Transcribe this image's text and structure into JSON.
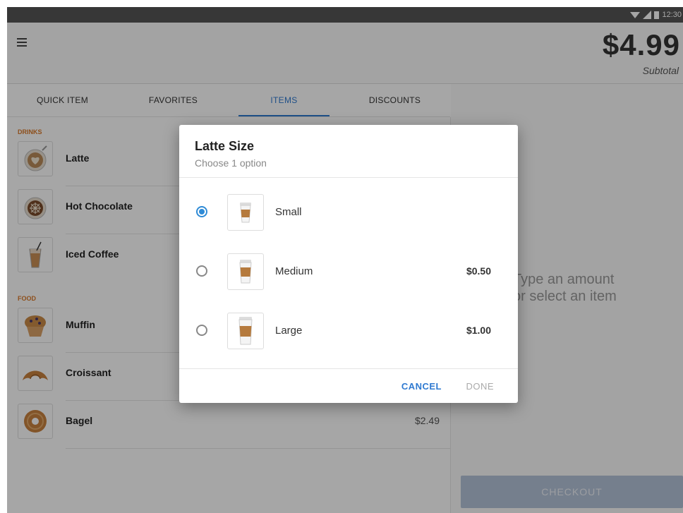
{
  "status_bar": {
    "time": "12:30"
  },
  "header": {
    "total": "$4.99",
    "subtotal_label": "Subtotal"
  },
  "tabs": [
    {
      "label": "QUICK ITEM",
      "active": false
    },
    {
      "label": "FAVORITES",
      "active": false
    },
    {
      "label": "ITEMS",
      "active": true
    },
    {
      "label": "DISCOUNTS",
      "active": false
    }
  ],
  "sections": [
    {
      "label": "DRINKS",
      "items": [
        {
          "name": "Latte",
          "icon": "latte-icon",
          "price": ""
        },
        {
          "name": "Hot Chocolate",
          "icon": "hot-chocolate-icon",
          "price": ""
        },
        {
          "name": "Iced Coffee",
          "icon": "iced-coffee-icon",
          "price": ""
        }
      ]
    },
    {
      "label": "FOOD",
      "items": [
        {
          "name": "Muffin",
          "icon": "muffin-icon",
          "price": ""
        },
        {
          "name": "Croissant",
          "icon": "croissant-icon",
          "price": ""
        },
        {
          "name": "Bagel",
          "icon": "bagel-icon",
          "price": "$2.49"
        }
      ]
    }
  ],
  "right_pane": {
    "placeholder_line1": "Type an amount",
    "placeholder_line2": "or select an item",
    "checkout_label": "CHECKOUT"
  },
  "dialog": {
    "title": "Latte Size",
    "subtitle": "Choose 1 option",
    "options": [
      {
        "label": "Small",
        "price": "",
        "selected": true,
        "icon": "small-cup-icon"
      },
      {
        "label": "Medium",
        "price": "$0.50",
        "selected": false,
        "icon": "medium-cup-icon"
      },
      {
        "label": "Large",
        "price": "$1.00",
        "selected": false,
        "icon": "large-cup-icon"
      }
    ],
    "cancel_label": "CANCEL",
    "done_label": "DONE"
  },
  "colors": {
    "accent": "#2f7ad1",
    "section_label": "#d97a2a",
    "checkout": "#b4c3d9"
  }
}
